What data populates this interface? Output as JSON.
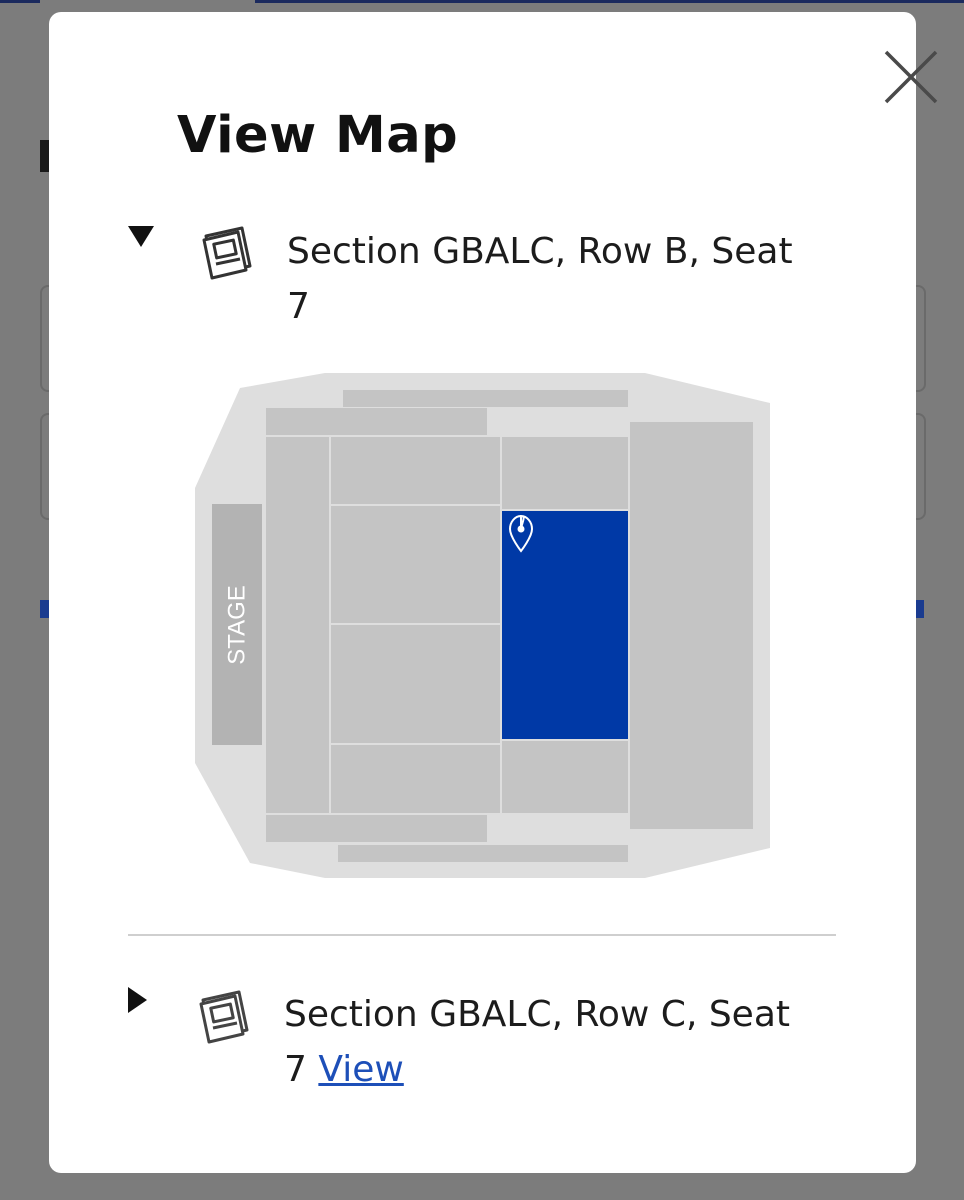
{
  "modal": {
    "title": "View Map",
    "close_icon": "close-icon",
    "items": [
      {
        "expanded": true,
        "caret_icon": "caret-down-icon",
        "icon": "ticket-icon",
        "label_line1": "Section GBALC, Row B, Seat",
        "label_line2": "7"
      },
      {
        "expanded": false,
        "caret_icon": "caret-right-icon",
        "icon": "ticket-icon",
        "label_line1": "Section GBALC, Row C, Seat",
        "label_line2": "7",
        "link_label": "View"
      }
    ]
  },
  "seat_map": {
    "stage_label": "STAGE",
    "selected_section_color": "#0039a6",
    "section_color": "#c4c4c4",
    "venue_color": "#dedede",
    "pin_icon": "location-pin-icon"
  }
}
